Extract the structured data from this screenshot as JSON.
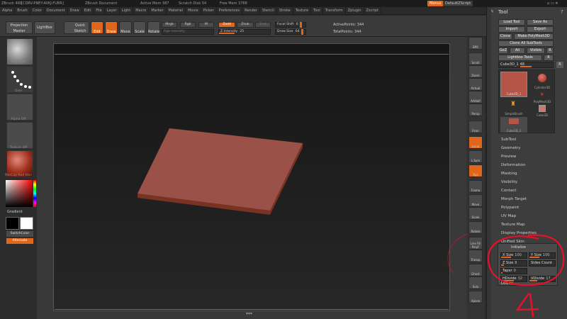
{
  "titlebar": {
    "app": "ZBrush 4R6",
    "serial": "[CDRV-PNEY-AVKJ-FUBR]",
    "document": "ZBrush Document",
    "active_mem": "Active Mem 387",
    "scratch_disk": "Scratch Disk 54",
    "free_mem": "Free Mem 3788",
    "menus_btn": "Menus",
    "script_btn": "DefaultZScript"
  },
  "menubar": [
    "Alpha",
    "Brush",
    "Color",
    "Document",
    "Draw",
    "Edit",
    "File",
    "Layer",
    "Light",
    "Macro",
    "Marker",
    "Material",
    "Movie",
    "Picker",
    "Preferences",
    "Render",
    "Stencil",
    "Stroke",
    "Texture",
    "Tool",
    "Transform",
    "Zplugin",
    "Zscript"
  ],
  "toolbar": {
    "projection_master": "Projection Master",
    "lightbox": "LightBox",
    "quick_sketch": "Quick Sketch",
    "edit": "Edit",
    "draw": "Draw",
    "move": "Move",
    "scale": "Scale",
    "rotate": "Rotate",
    "mrgb": "Mrgb",
    "rgb": "Rgb",
    "m": "M",
    "zadd": "Zadd",
    "zsub": "Zsub",
    "zcut": "Zcut",
    "rgb_intensity": "Rgb Intensity",
    "z_intensity": "Z Intensity",
    "z_intensity_val": "25",
    "focal_shift": "Focal Shift",
    "focal_shift_val": "0",
    "draw_size": "Draw Size",
    "draw_size_val": "64",
    "active_points": "ActivePoints: 344",
    "total_points": "TotalPoints: 344"
  },
  "leftshelf": {
    "brush_label": "Standard",
    "stroke_label": "Dots",
    "alpha_label": "Alpha Off",
    "texture_label": "Texture Off",
    "material_label": "MatCap Red Wax",
    "gradient_label": "Gradient",
    "switch_color": "SwitchColor",
    "alternate": "Alternate"
  },
  "rightshelf": [
    "BPR",
    "Scroll",
    "Zoom",
    "Actual",
    "AAHalf",
    "Persp",
    "Floor",
    "Local",
    "L.Sym",
    "Xyz",
    "Frame",
    "Move",
    "Scale",
    "Rotate",
    "Line Fill PolyF",
    "Transp",
    "Ghost",
    "Solo",
    "Xpose"
  ],
  "tray": {
    "title": "Tool",
    "load_tool": "Load Tool",
    "save_as": "Save As",
    "import": "Import",
    "export": "Export",
    "clone": "Clone",
    "make_polymesh": "Make PolyMesh3D",
    "clone_all": "Clone All SubTools",
    "goz": "GoZ",
    "all": "All",
    "visible": "Visible",
    "r": "R",
    "lightbox_tools": "Lightbox Tools",
    "current_tool": "Cube3D_1",
    "current_tool_count": "48",
    "thumbs": [
      "Cube3D_1",
      "Cylinder3D",
      "PolyMesh3D",
      "SimpleBrush",
      "Cube3D",
      "Cube3D_1"
    ],
    "subpalettes": [
      "SubTool",
      "Geometry",
      "Preview",
      "Deformation",
      "Masking",
      "Visibility",
      "Contact",
      "Morph Target",
      "Polypaint",
      "UV Map",
      "Texture Map",
      "Display Properties",
      "Unified Skin"
    ],
    "initialize": {
      "title": "Initialize",
      "x_size": "X Size",
      "x_val": "100",
      "y_size": "Y Size",
      "y_val": "100",
      "z_size": "Z Size",
      "z_val": "8",
      "sides_count": "Sides Count",
      "taper": "Taper",
      "taper_val": "0",
      "hdivide": "HDivide",
      "hdivide_val": "32",
      "vdivide": "VDivide",
      "vdivide_val": "17"
    },
    "lower": "Lower"
  },
  "annotation": {
    "number": "4",
    "color": "#e8102a"
  },
  "colors": {
    "accent": "#e0661c",
    "slab_top": "#9a5248",
    "slab_side": "#7a3323"
  }
}
